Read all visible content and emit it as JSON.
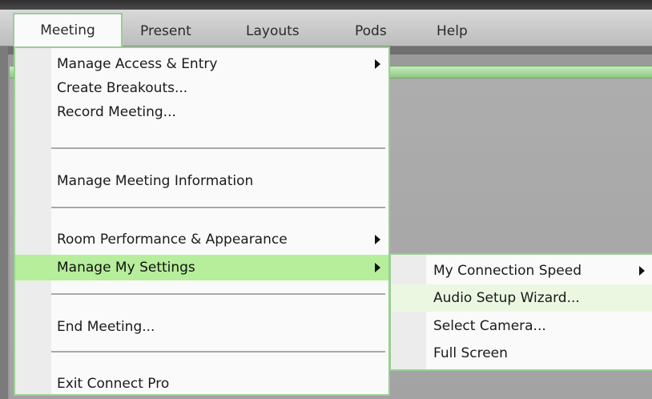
{
  "menubar": {
    "items": [
      {
        "label": "Meeting",
        "active": true
      },
      {
        "label": "Present",
        "active": false
      },
      {
        "label": "Layouts",
        "active": false
      },
      {
        "label": "Pods",
        "active": false
      },
      {
        "label": "Help",
        "active": false
      }
    ]
  },
  "meeting_menu": {
    "items": [
      {
        "label": "Manage Access & Entry",
        "has_submenu": true
      },
      {
        "label": "Create Breakouts...",
        "has_submenu": false
      },
      {
        "label": "Record Meeting...",
        "has_submenu": false
      },
      {
        "label": "Manage Meeting Information",
        "has_submenu": false
      },
      {
        "label": "Room Performance & Appearance",
        "has_submenu": true
      },
      {
        "label": "Manage My Settings",
        "has_submenu": true,
        "highlighted": true
      },
      {
        "label": "End Meeting...",
        "has_submenu": false
      },
      {
        "label": "Exit Connect Pro",
        "has_submenu": false
      }
    ]
  },
  "settings_submenu": {
    "items": [
      {
        "label": "My Connection Speed",
        "has_submenu": true
      },
      {
        "label": "Audio Setup Wizard...",
        "has_submenu": false,
        "hovered": true
      },
      {
        "label": "Select Camera...",
        "has_submenu": false
      },
      {
        "label": "Full Screen",
        "has_submenu": false
      }
    ]
  },
  "colors": {
    "menu_border": "#98cf94",
    "highlight": "#b6ee9c",
    "hover": "#ebf7e1",
    "pod_header": "#8cc97f"
  }
}
